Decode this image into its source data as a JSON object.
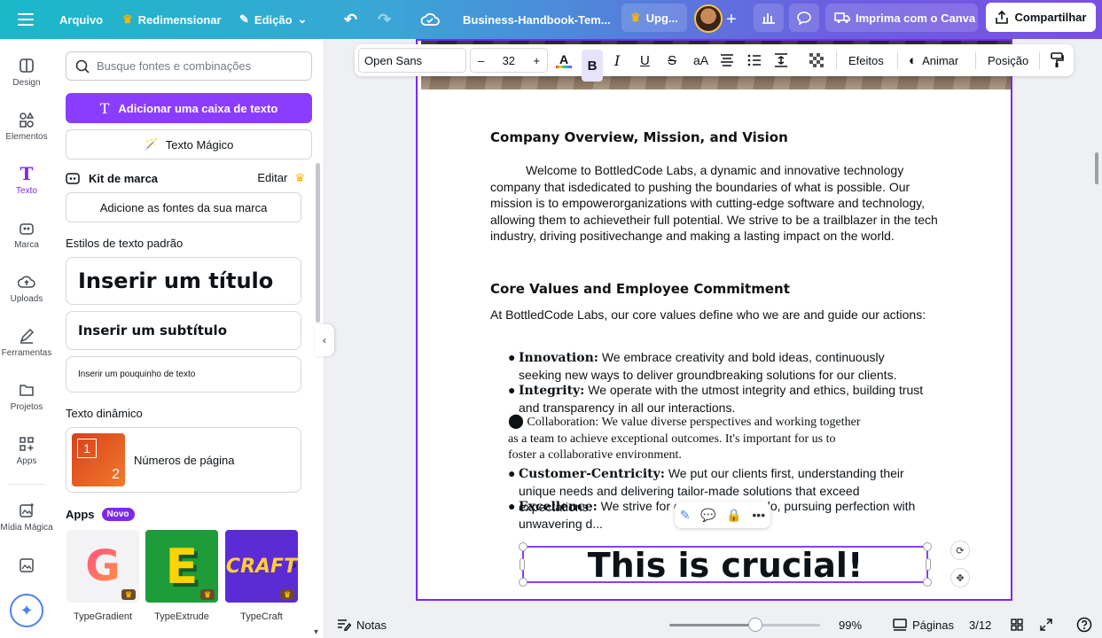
{
  "topbar": {
    "file": "Arquivo",
    "resize": "Redimensionar",
    "edit": "Edição",
    "doc_title": "Business-Handbook-Tem...",
    "upgrade": "Upg...",
    "print": "Imprima com o Canva",
    "share": "Compartilhar"
  },
  "rail": {
    "design": "Design",
    "elements": "Elementos",
    "text": "Texto",
    "brand": "Marca",
    "uploads": "Uploads",
    "tools": "Ferramentas",
    "projects": "Projetos",
    "apps": "Apps",
    "magic_media": "Mídia Mágica"
  },
  "panel": {
    "search_placeholder": "Busque fontes e combinações",
    "add_textbox": "Adicionar uma caixa de texto",
    "magic_text": "Texto Mágico",
    "brand_kit": "Kit de marca",
    "brand_edit": "Editar",
    "add_brand_fonts": "Adicione as fontes da sua marca",
    "default_styles": "Estilos de texto padrão",
    "insert_title": "Inserir um título",
    "insert_subtitle": "Inserir um subtítulo",
    "insert_body": "Inserir um pouquinho de texto",
    "dynamic_text": "Texto dinâmico",
    "page_numbers": "Números de página",
    "apps_title": "Apps",
    "new_badge": "Novo",
    "apps": [
      {
        "name": "TypeGradient"
      },
      {
        "name": "TypeExtrude"
      },
      {
        "name": "TypeCraft"
      }
    ]
  },
  "toolbar": {
    "font": "Open Sans",
    "size": "32",
    "effects": "Efeitos",
    "animate": "Animar",
    "position": "Posição"
  },
  "document": {
    "h1": "Company Overview, Mission, and Vision",
    "p1": "Welcome to BottledCode Labs, a dynamic and innovative technology company that isdedicated to pushing the boundaries of what is possible. Our mission is to empowerorganizations with cutting-edge software and technology, allowing them to achievetheir full potential. We strive to be a trailblazer in the tech industry, driving positivechange and making a lasting impact on the world.",
    "h2": "Core Values and Employee Commitment",
    "p2": "At BottledCode Labs, our core values define who we are and guide our actions:",
    "values": [
      {
        "term": "Innovation:",
        "text": "We embrace creativity and bold ideas, continuously seeking new ways to deliver groundbreaking solutions for our clients."
      },
      {
        "term": "Integrity:",
        "text": "We operate with the utmost integrity and ethics, building trust and transparency in all our interactions."
      },
      {
        "term": "",
        "text": "Collaboration: We value diverse perspectives and working together as a team to achieve exceptional outcomes. It's important for us to foster a collaborative environment."
      },
      {
        "term": "Customer-Centricity:",
        "text": "We put our clients first, understanding their unique needs and delivering tailor-made solutions that exceed expectations."
      },
      {
        "term": "Excellence:",
        "text": "We strive for exc... ...hing we do, pursuing perfection with unwavering d..."
      }
    ],
    "selected_text": "This is crucial!"
  },
  "footer": {
    "notes": "Notas",
    "zoom": "99%",
    "pages": "Páginas",
    "page_count": "3/12",
    "zoom_fraction": 0.57
  }
}
